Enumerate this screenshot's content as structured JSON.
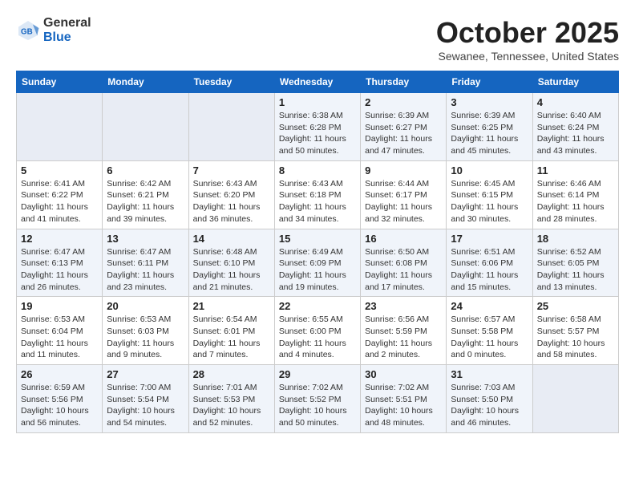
{
  "header": {
    "logo_general": "General",
    "logo_blue": "Blue",
    "month_title": "October 2025",
    "subtitle": "Sewanee, Tennessee, United States"
  },
  "days_of_week": [
    "Sunday",
    "Monday",
    "Tuesday",
    "Wednesday",
    "Thursday",
    "Friday",
    "Saturday"
  ],
  "weeks": [
    [
      {
        "day": "",
        "info": ""
      },
      {
        "day": "",
        "info": ""
      },
      {
        "day": "",
        "info": ""
      },
      {
        "day": "1",
        "info": "Sunrise: 6:38 AM\nSunset: 6:28 PM\nDaylight: 11 hours and 50 minutes."
      },
      {
        "day": "2",
        "info": "Sunrise: 6:39 AM\nSunset: 6:27 PM\nDaylight: 11 hours and 47 minutes."
      },
      {
        "day": "3",
        "info": "Sunrise: 6:39 AM\nSunset: 6:25 PM\nDaylight: 11 hours and 45 minutes."
      },
      {
        "day": "4",
        "info": "Sunrise: 6:40 AM\nSunset: 6:24 PM\nDaylight: 11 hours and 43 minutes."
      }
    ],
    [
      {
        "day": "5",
        "info": "Sunrise: 6:41 AM\nSunset: 6:22 PM\nDaylight: 11 hours and 41 minutes."
      },
      {
        "day": "6",
        "info": "Sunrise: 6:42 AM\nSunset: 6:21 PM\nDaylight: 11 hours and 39 minutes."
      },
      {
        "day": "7",
        "info": "Sunrise: 6:43 AM\nSunset: 6:20 PM\nDaylight: 11 hours and 36 minutes."
      },
      {
        "day": "8",
        "info": "Sunrise: 6:43 AM\nSunset: 6:18 PM\nDaylight: 11 hours and 34 minutes."
      },
      {
        "day": "9",
        "info": "Sunrise: 6:44 AM\nSunset: 6:17 PM\nDaylight: 11 hours and 32 minutes."
      },
      {
        "day": "10",
        "info": "Sunrise: 6:45 AM\nSunset: 6:15 PM\nDaylight: 11 hours and 30 minutes."
      },
      {
        "day": "11",
        "info": "Sunrise: 6:46 AM\nSunset: 6:14 PM\nDaylight: 11 hours and 28 minutes."
      }
    ],
    [
      {
        "day": "12",
        "info": "Sunrise: 6:47 AM\nSunset: 6:13 PM\nDaylight: 11 hours and 26 minutes."
      },
      {
        "day": "13",
        "info": "Sunrise: 6:47 AM\nSunset: 6:11 PM\nDaylight: 11 hours and 23 minutes."
      },
      {
        "day": "14",
        "info": "Sunrise: 6:48 AM\nSunset: 6:10 PM\nDaylight: 11 hours and 21 minutes."
      },
      {
        "day": "15",
        "info": "Sunrise: 6:49 AM\nSunset: 6:09 PM\nDaylight: 11 hours and 19 minutes."
      },
      {
        "day": "16",
        "info": "Sunrise: 6:50 AM\nSunset: 6:08 PM\nDaylight: 11 hours and 17 minutes."
      },
      {
        "day": "17",
        "info": "Sunrise: 6:51 AM\nSunset: 6:06 PM\nDaylight: 11 hours and 15 minutes."
      },
      {
        "day": "18",
        "info": "Sunrise: 6:52 AM\nSunset: 6:05 PM\nDaylight: 11 hours and 13 minutes."
      }
    ],
    [
      {
        "day": "19",
        "info": "Sunrise: 6:53 AM\nSunset: 6:04 PM\nDaylight: 11 hours and 11 minutes."
      },
      {
        "day": "20",
        "info": "Sunrise: 6:53 AM\nSunset: 6:03 PM\nDaylight: 11 hours and 9 minutes."
      },
      {
        "day": "21",
        "info": "Sunrise: 6:54 AM\nSunset: 6:01 PM\nDaylight: 11 hours and 7 minutes."
      },
      {
        "day": "22",
        "info": "Sunrise: 6:55 AM\nSunset: 6:00 PM\nDaylight: 11 hours and 4 minutes."
      },
      {
        "day": "23",
        "info": "Sunrise: 6:56 AM\nSunset: 5:59 PM\nDaylight: 11 hours and 2 minutes."
      },
      {
        "day": "24",
        "info": "Sunrise: 6:57 AM\nSunset: 5:58 PM\nDaylight: 11 hours and 0 minutes."
      },
      {
        "day": "25",
        "info": "Sunrise: 6:58 AM\nSunset: 5:57 PM\nDaylight: 10 hours and 58 minutes."
      }
    ],
    [
      {
        "day": "26",
        "info": "Sunrise: 6:59 AM\nSunset: 5:56 PM\nDaylight: 10 hours and 56 minutes."
      },
      {
        "day": "27",
        "info": "Sunrise: 7:00 AM\nSunset: 5:54 PM\nDaylight: 10 hours and 54 minutes."
      },
      {
        "day": "28",
        "info": "Sunrise: 7:01 AM\nSunset: 5:53 PM\nDaylight: 10 hours and 52 minutes."
      },
      {
        "day": "29",
        "info": "Sunrise: 7:02 AM\nSunset: 5:52 PM\nDaylight: 10 hours and 50 minutes."
      },
      {
        "day": "30",
        "info": "Sunrise: 7:02 AM\nSunset: 5:51 PM\nDaylight: 10 hours and 48 minutes."
      },
      {
        "day": "31",
        "info": "Sunrise: 7:03 AM\nSunset: 5:50 PM\nDaylight: 10 hours and 46 minutes."
      },
      {
        "day": "",
        "info": ""
      }
    ]
  ]
}
